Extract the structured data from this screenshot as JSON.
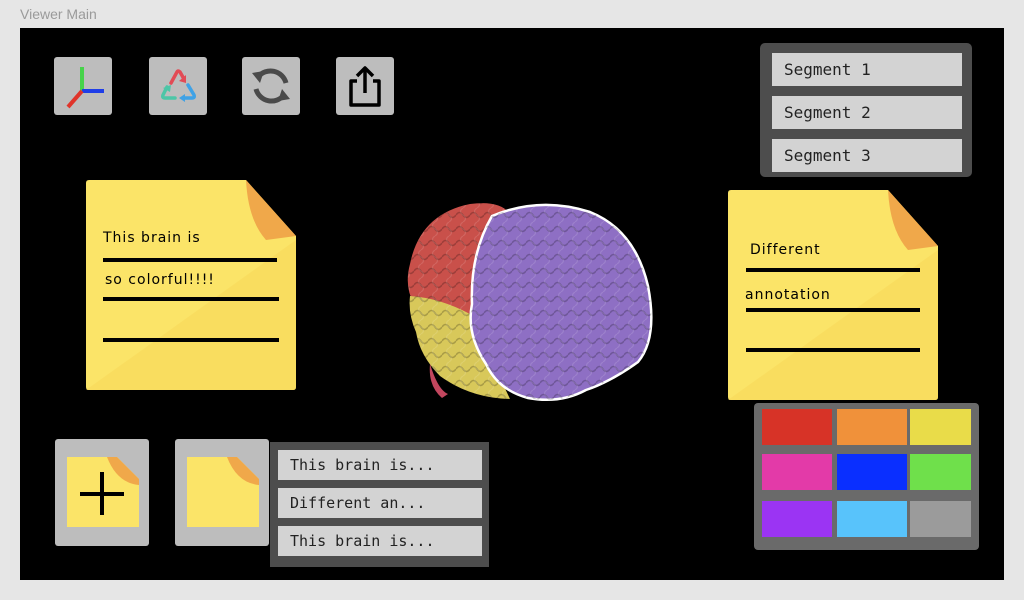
{
  "window": {
    "title": "Viewer Main"
  },
  "toolbar": {
    "buttons": [
      {
        "name": "axes-icon"
      },
      {
        "name": "recycle-icon"
      },
      {
        "name": "refresh-icon"
      },
      {
        "name": "share-icon"
      }
    ],
    "caption": ""
  },
  "segments": {
    "items": [
      {
        "label": "Segment 1"
      },
      {
        "label": "Segment 2"
      },
      {
        "label": "Segment 3"
      }
    ]
  },
  "notes": {
    "left": {
      "line1": "This brain is",
      "line2": "so colorful!!!!"
    },
    "right": {
      "line1": "Different",
      "line2": "annotation"
    }
  },
  "brain": {
    "colors": {
      "red": "#c9504a",
      "yellow": "#d8c85a",
      "purple": "#8e6fc4",
      "pink": "#c2465e"
    }
  },
  "annotations": {
    "caption": "",
    "items": [
      {
        "label": "This brain is..."
      },
      {
        "label": "Different an..."
      },
      {
        "label": "This brain is..."
      }
    ]
  },
  "palette": {
    "colors": [
      "#d73327",
      "#f0913a",
      "#e9dc49",
      "#e33aa8",
      "#0a2fff",
      "#6fe04b",
      "#9b34f3",
      "#58c3fb",
      "#9b9b9b"
    ]
  },
  "theme": {
    "note_yellow": "#fbe468",
    "note_fold": "#f0a84a",
    "button_gray": "#bdbdbd"
  }
}
